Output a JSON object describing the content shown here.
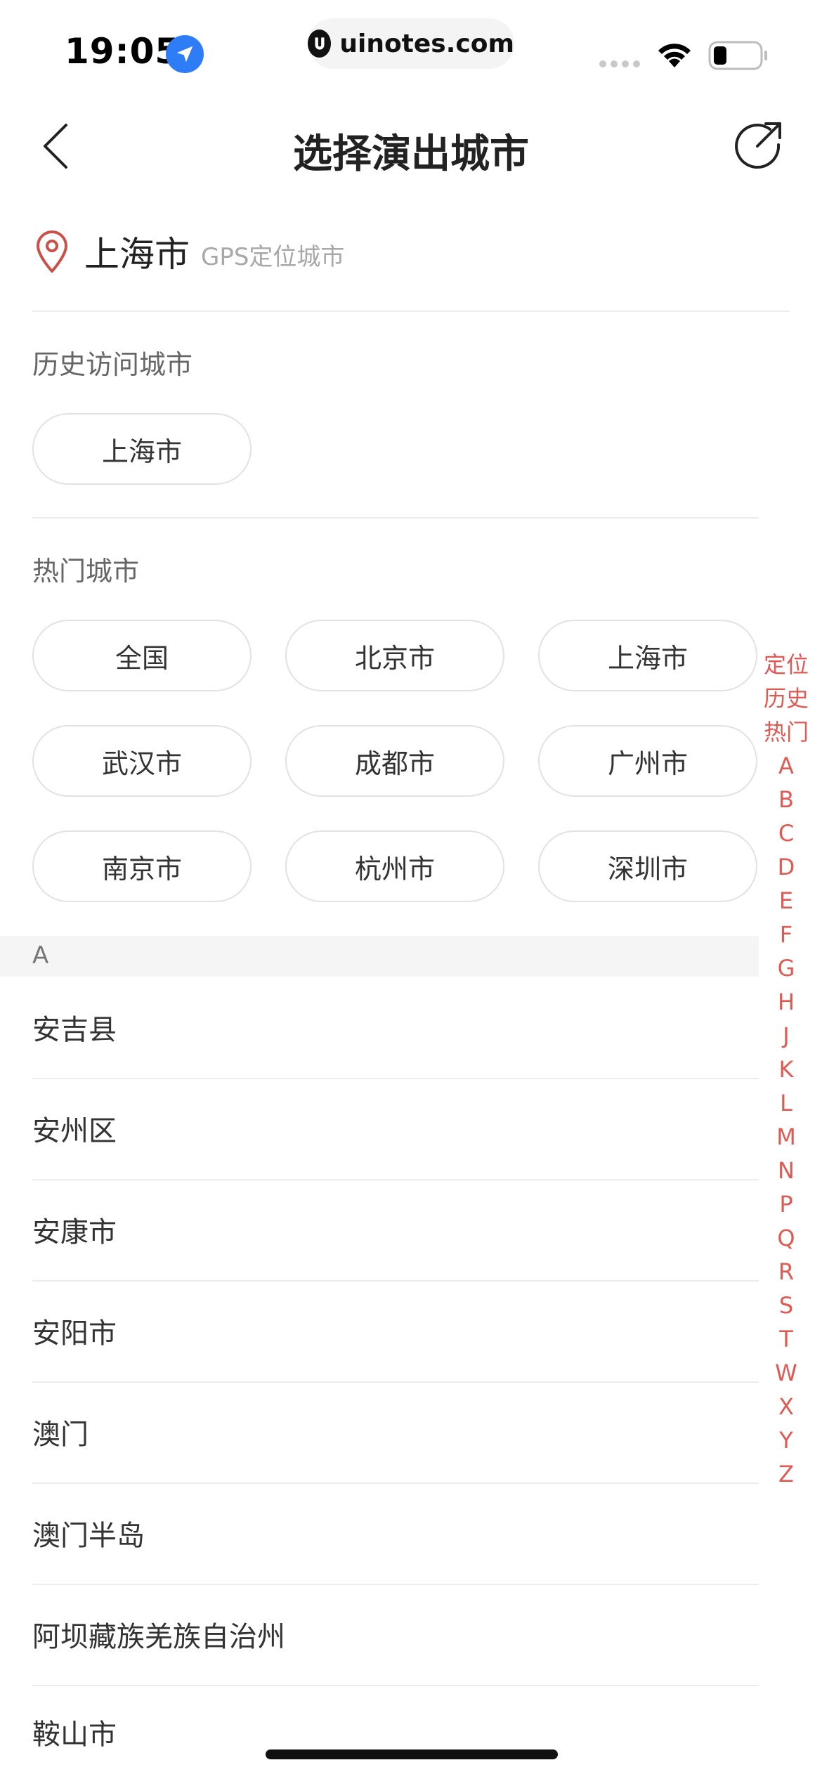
{
  "status_bar": {
    "time": "19:05",
    "url": "uinotes.com"
  },
  "nav": {
    "title": "选择演出城市"
  },
  "gps": {
    "city": "上海市",
    "label": "GPS定位城市"
  },
  "history": {
    "title": "历史访问城市",
    "cities": [
      "上海市"
    ]
  },
  "hot": {
    "title": "热门城市",
    "cities": [
      "全国",
      "北京市",
      "上海市",
      "武汉市",
      "成都市",
      "广州市",
      "南京市",
      "杭州市",
      "深圳市"
    ]
  },
  "list": {
    "letter": "A",
    "cities": [
      "安吉县",
      "安州区",
      "安康市",
      "安阳市",
      "澳门",
      "澳门半岛",
      "阿坝藏族羌族自治州",
      "鞍山市"
    ]
  },
  "index": [
    "定位",
    "历史",
    "热门",
    "A",
    "B",
    "C",
    "D",
    "E",
    "F",
    "G",
    "H",
    "J",
    "K",
    "L",
    "M",
    "N",
    "P",
    "Q",
    "R",
    "S",
    "T",
    "W",
    "X",
    "Y",
    "Z"
  ],
  "colors": {
    "accent": "#e05a53",
    "location_badge": "#2e7cf6"
  }
}
